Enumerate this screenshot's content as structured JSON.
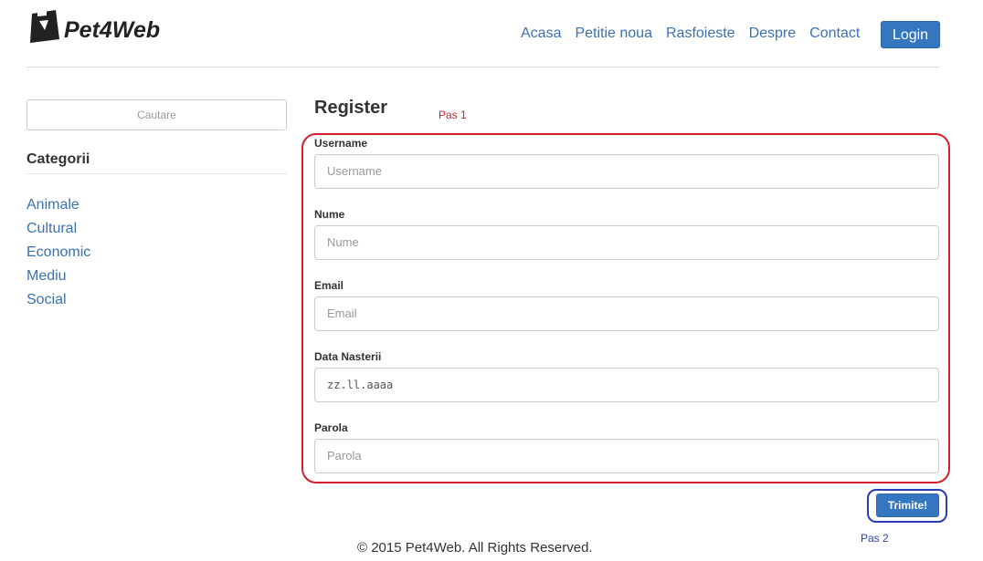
{
  "brand": {
    "name": "Pet4Web"
  },
  "nav": {
    "items": [
      "Acasa",
      "Petitie noua",
      "Rasfoieste",
      "Despre",
      "Contact"
    ],
    "login_label": "Login"
  },
  "sidebar": {
    "search_placeholder": "Cautare",
    "categories_title": "Categorii",
    "categories": [
      "Animale",
      "Cultural",
      "Economic",
      "Mediu",
      "Social"
    ]
  },
  "form": {
    "title": "Register",
    "step1_label": "Pas 1",
    "fields": [
      {
        "label": "Username",
        "placeholder": "Username"
      },
      {
        "label": "Nume",
        "placeholder": "Nume"
      },
      {
        "label": "Email",
        "placeholder": "Email"
      },
      {
        "label": "Data Nasterii",
        "placeholder": "zz.ll.aaaa"
      },
      {
        "label": "Parola",
        "placeholder": "Parola"
      }
    ],
    "submit_label": "Trimite!",
    "step2_label": "Pas 2"
  },
  "annotation_colors": {
    "step1_frame": "#d4202c",
    "step2_frame": "#2b3cb8",
    "accent": "#3477c0"
  },
  "footer": {
    "text": "© 2015 Pet4Web. All Rights Reserved."
  }
}
